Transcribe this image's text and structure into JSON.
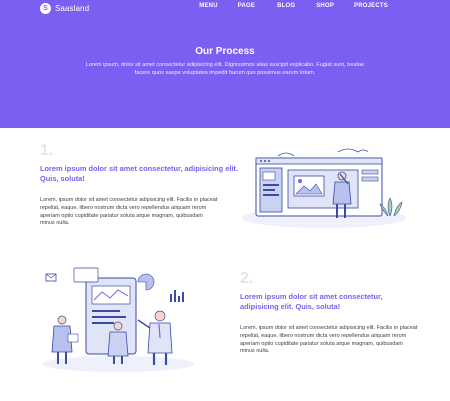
{
  "header": {
    "logo_text": "Saasland",
    "logo_mark": "S",
    "nav": [
      "MENU",
      "PAGE",
      "BLOG",
      "SHOP",
      "PROJECTS"
    ]
  },
  "hero": {
    "title": "Our Process",
    "text": "Lorem ipsum, dolor sit amet consectetur adipisicing elit. Dignissimos alias suscipit explicabo. Fugiat sunt, beatae facere quos saepe voluptates impedit harum quo possimus earum totam."
  },
  "steps": [
    {
      "number": "1.",
      "title": "Lorem ipsum dolor sit amet consectetur, adipisicing elit. Quis, soluta!",
      "text": "Lorem, ipsum dolor sit amet consectetur adipisicing elit. Facilis in placeat repellat, eaque, libero nostrum dicta vero repellendus aliquam rerum aperiam optio cupiditate pariatur soluta atque magnam, quibusdam minus nulla."
    },
    {
      "number": "2.",
      "title": "Lorem ipsum dolor sit amet consectetur, adipisicing elit. Quis, soluta!",
      "text": "Lorem, ipsum dolor sit amet consectetur adipisicing elit. Facilis in placeat repellat, eaque, libero nostrum dicta vero repellendus aliquam rerum aperiam optio cupiditate pariatur soluta atque magnam, quibusdam minus nulla."
    }
  ],
  "colors": {
    "brand": "#7a5ff2",
    "illustration_fill": "#dfe4f7",
    "illustration_stroke": "#3b4aa3"
  }
}
